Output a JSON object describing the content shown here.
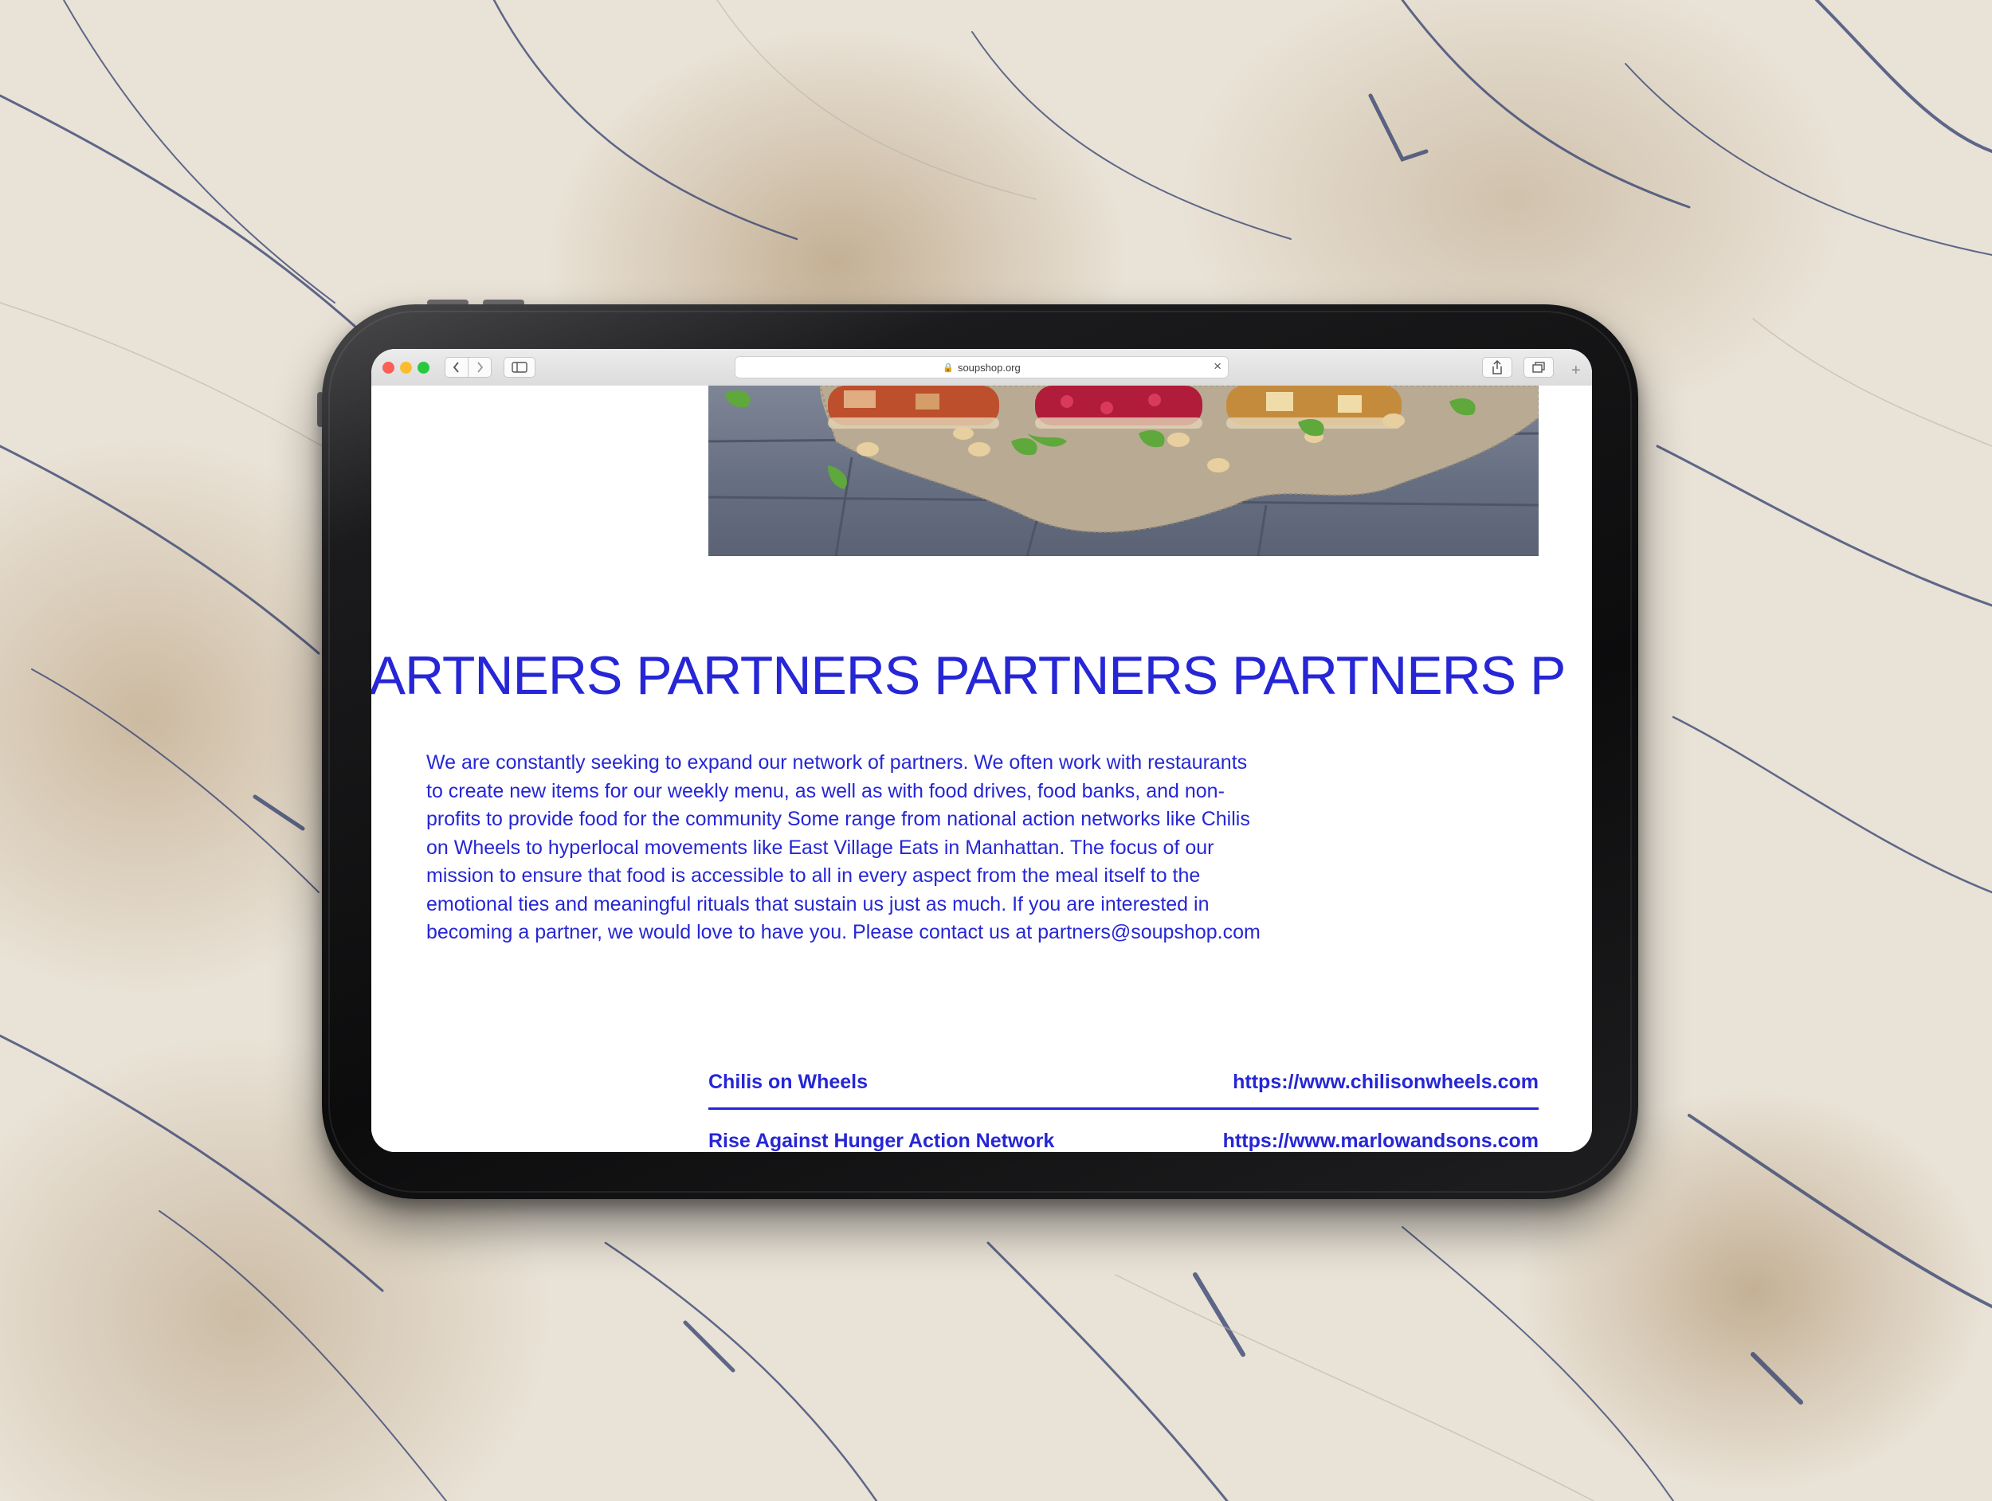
{
  "browser": {
    "url": "soupshop.org"
  },
  "page": {
    "marquee": "RS PARTNERS PARTNERS PARTNERS PARTNERS P",
    "intro": "We are constantly seeking to expand our network of partners. We often work with restaurants to create new items for our weekly menu, as well as with food drives, food banks, and non-profits to provide food for the community Some range from national action networks like Chilis on Wheels to hyperlocal movements like East Village Eats in Manhattan. The focus of our mission to ensure that food is accessible to all in every aspect from the meal itself to the emotional ties and meaningful rituals that sustain us just as much. If you are interested in becoming a partner, we would love to have you. Please contact us at partners@soupshop.com",
    "partners": [
      {
        "name": "Chilis on Wheels",
        "url": "https://www.chilisonwheels.com"
      },
      {
        "name": "Rise Against Hunger Action Network",
        "url": "https://www.marlowandsons.com"
      }
    ]
  },
  "colors": {
    "accent": "#2626d6"
  }
}
